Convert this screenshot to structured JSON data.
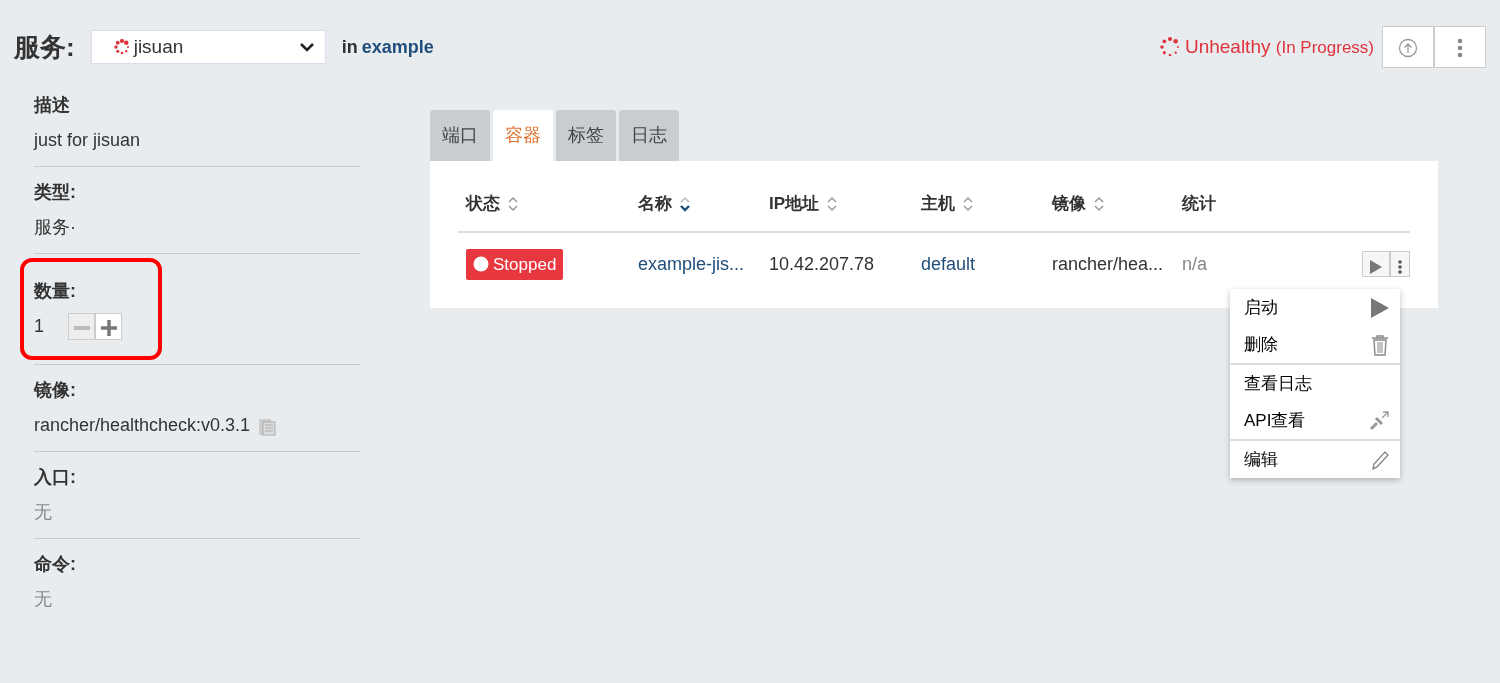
{
  "header": {
    "title": "服务:",
    "service": "jisuan",
    "in_text": "in",
    "stack": "example",
    "health": "Unhealthy",
    "health_detail": "(In Progress)"
  },
  "details": [
    {
      "label": "描述",
      "value": "just for jisuan",
      "kind": "text",
      "highlighted": false
    },
    {
      "label": "类型:",
      "value": "服务·",
      "kind": "text",
      "highlighted": false
    },
    {
      "label": "数量:",
      "value": "1",
      "kind": "scale",
      "highlighted": true
    },
    {
      "label": "镜像:",
      "value": "rancher/healthcheck:v0.3.1",
      "kind": "copy",
      "highlighted": false
    },
    {
      "label": "入口:",
      "value": "无",
      "kind": "muted",
      "highlighted": false
    },
    {
      "label": "命令:",
      "value": "无",
      "kind": "muted",
      "highlighted": false
    }
  ],
  "tabs": [
    {
      "label": "端口",
      "selected": false
    },
    {
      "label": "容器",
      "selected": true
    },
    {
      "label": "标签",
      "selected": false
    },
    {
      "label": "日志",
      "selected": false
    }
  ],
  "table": {
    "columns": [
      {
        "label": "状态",
        "sortable": true,
        "sorted": false
      },
      {
        "label": "名称",
        "sortable": true,
        "sorted": true
      },
      {
        "label": "IP地址",
        "sortable": true,
        "sorted": false
      },
      {
        "label": "主机",
        "sortable": true,
        "sorted": false
      },
      {
        "label": "镜像",
        "sortable": true,
        "sorted": false
      },
      {
        "label": "统计",
        "sortable": false,
        "sorted": false
      }
    ],
    "rows": [
      {
        "state": "Stopped",
        "name": "example-jis...",
        "ip": "10.42.207.78",
        "host": "default",
        "image": "rancher/hea...",
        "stats": "n/a"
      }
    ]
  },
  "menu": [
    [
      {
        "label": "启动",
        "kind": "start"
      },
      {
        "label": "删除",
        "kind": "delete"
      }
    ],
    [
      {
        "label": "查看日志",
        "kind": "logs"
      },
      {
        "label": "API查看",
        "kind": "api"
      }
    ],
    [
      {
        "label": "编辑",
        "kind": "edit"
      }
    ]
  ]
}
